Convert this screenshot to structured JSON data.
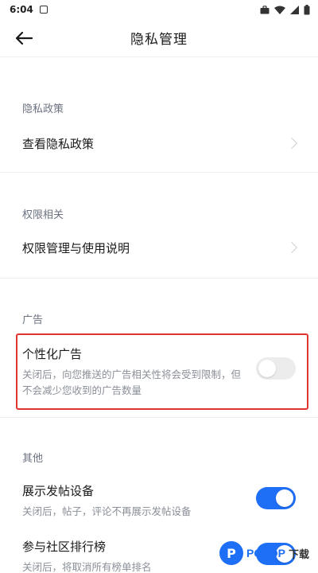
{
  "status_bar": {
    "time": "6:04"
  },
  "header": {
    "title": "隐私管理"
  },
  "sections": [
    {
      "label": "隐私政策",
      "row": "查看隐私政策"
    },
    {
      "label": "权限相关",
      "row": "权限管理与使用说明"
    },
    {
      "label": "广告"
    },
    {
      "label": "其他"
    }
  ],
  "ad_setting": {
    "title": "个性化广告",
    "desc": "关闭后，向您推送的广告相关性将会受到限制，但不会减少您收到的广告数量",
    "enabled": false
  },
  "other_settings": [
    {
      "title": "展示发帖设备",
      "desc": "关闭后，帖子，评论不再展示发帖设备",
      "enabled": true
    },
    {
      "title": "参与社区排行榜",
      "desc": "关闭后，将取消所有榜单排名",
      "enabled": true
    }
  ],
  "watermark": {
    "logo": "P",
    "brand": "PCPOP",
    "suffix": "下载"
  },
  "colors": {
    "accent": "#1e6ff5",
    "highlight_border": "#e0342c",
    "toggle_off": "#ececec"
  }
}
